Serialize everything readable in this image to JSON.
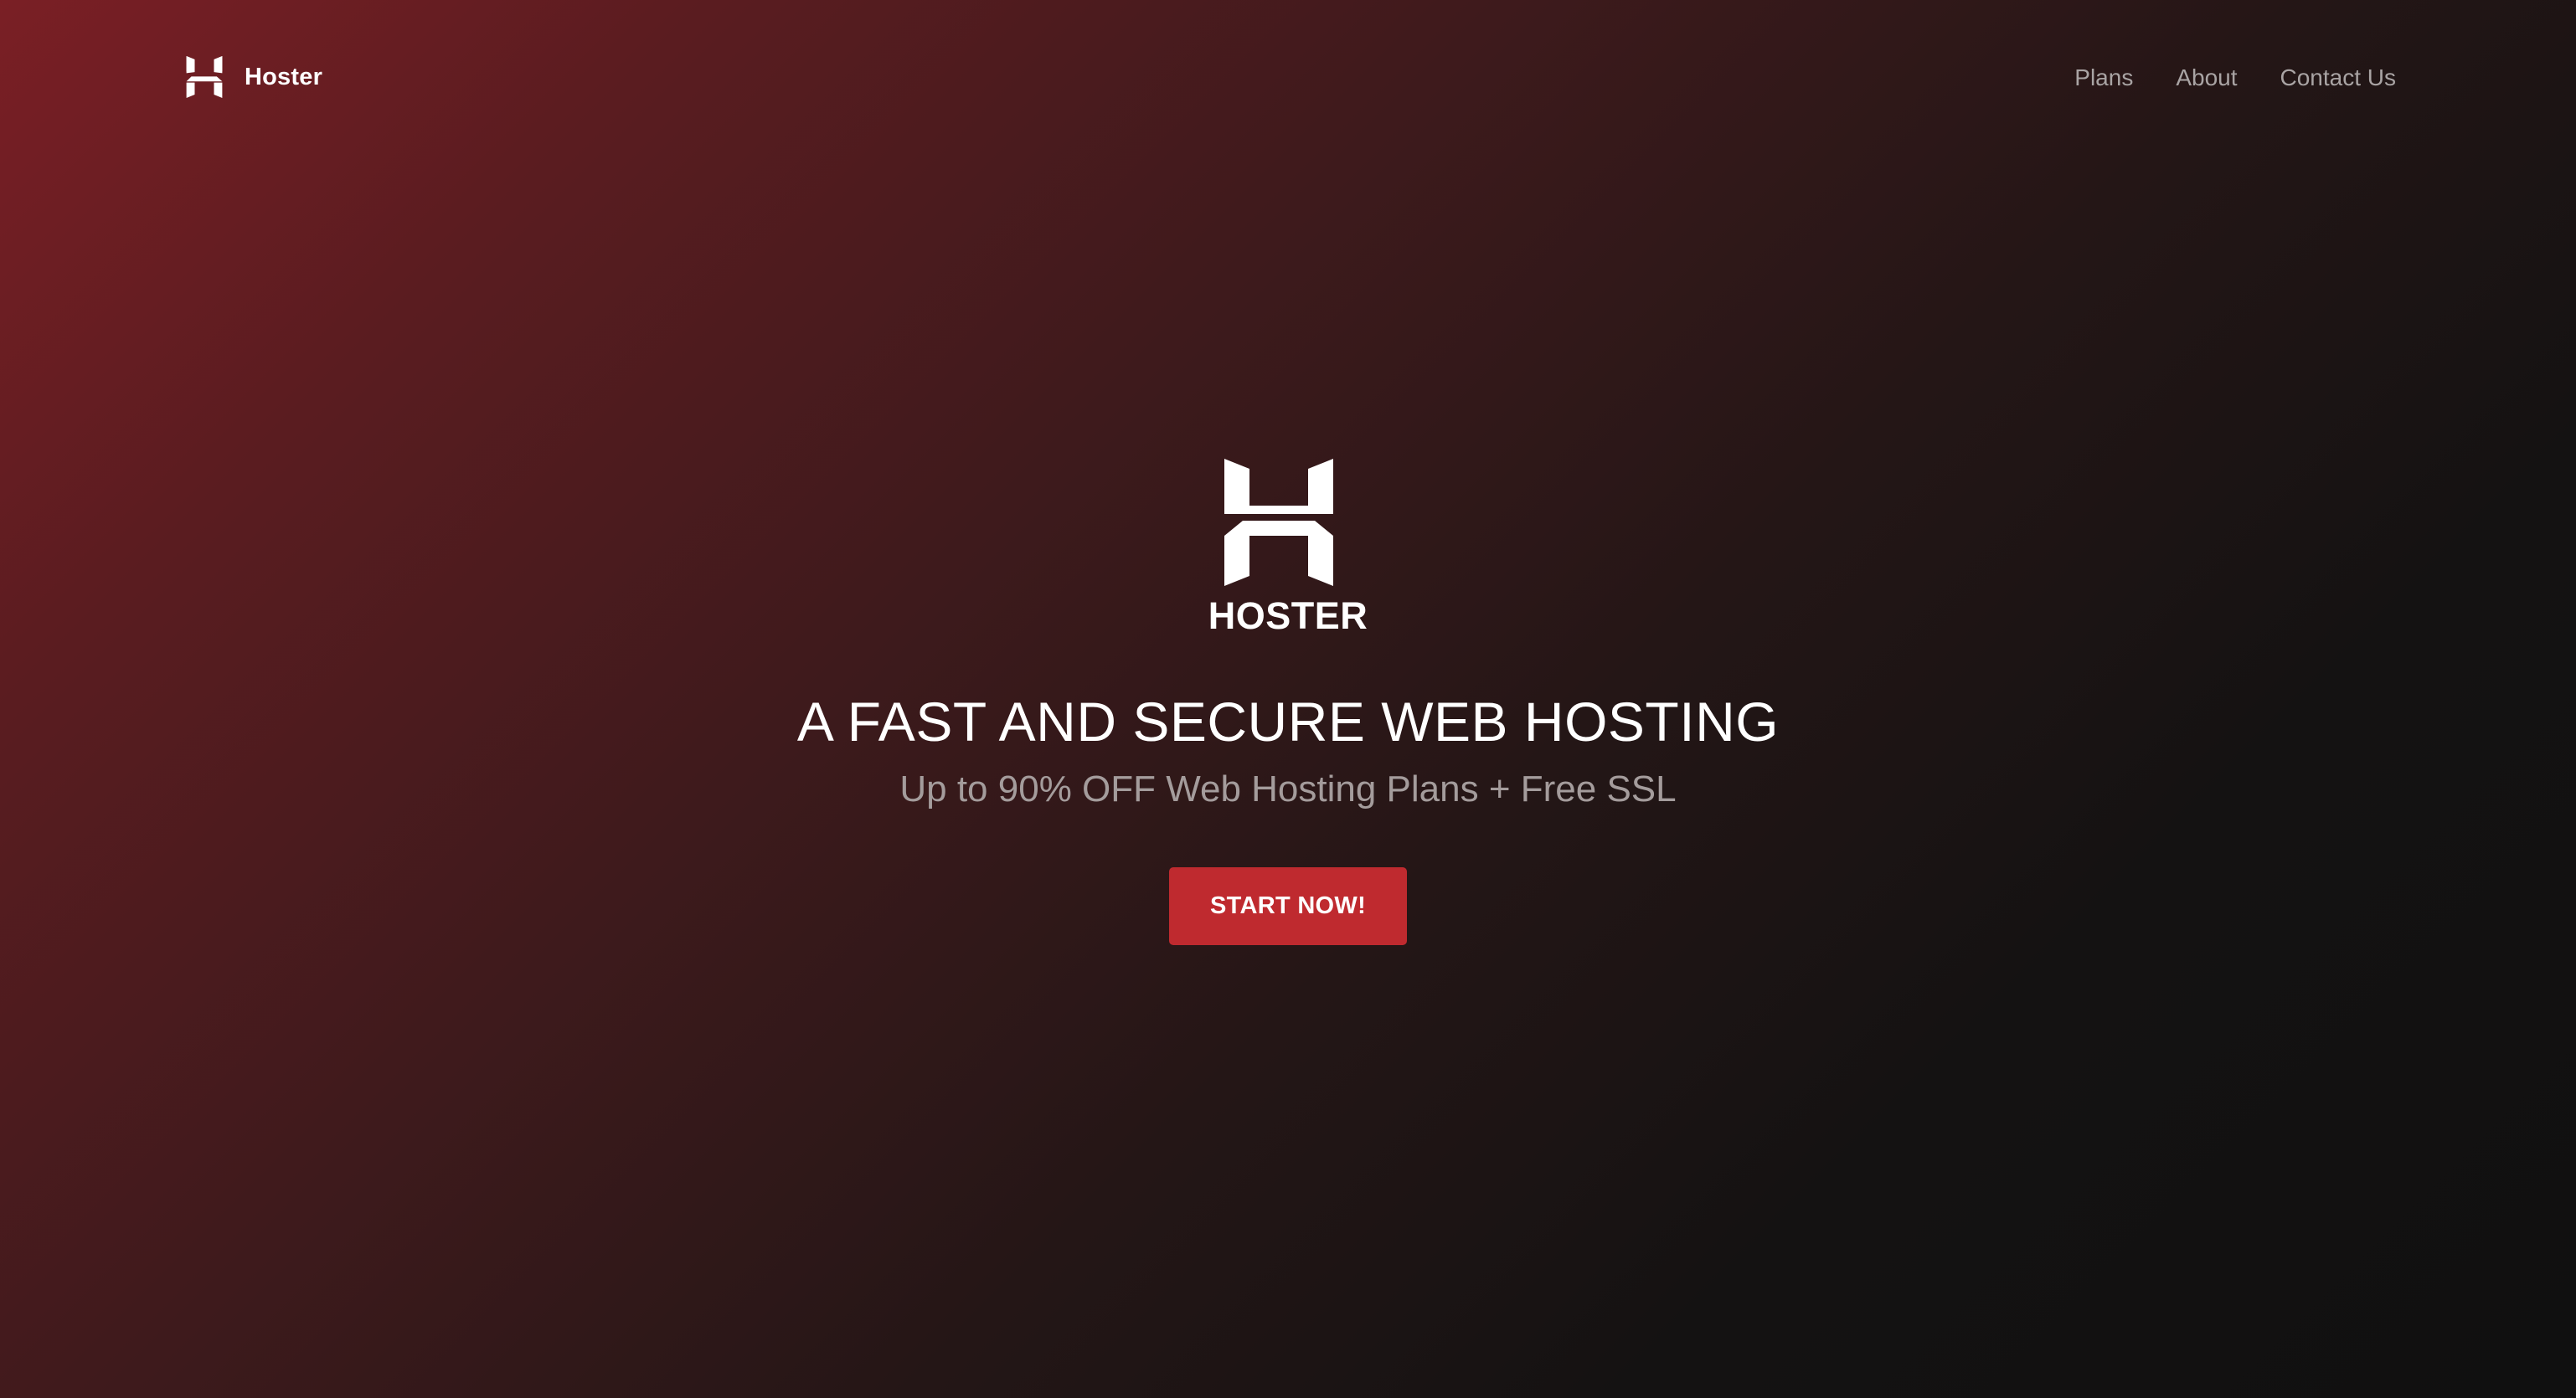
{
  "navbar": {
    "brand_name": "Hoster",
    "links": [
      {
        "label": "Plans"
      },
      {
        "label": "About"
      },
      {
        "label": "Contact Us"
      }
    ]
  },
  "hero": {
    "logo_text": "HOSTER",
    "title": "A FAST AND SECURE WEB HOSTING",
    "subtitle": "Up to 90% OFF Web Hosting Plans + Free SSL",
    "cta_label": "START NOW!"
  },
  "colors": {
    "accent": "#bf2a2f",
    "background_start": "#7a1f25",
    "background_end": "#101010",
    "nav_text": "#a9a4a4",
    "subtitle_text": "#a49c9c"
  },
  "icons": {
    "brand_logo": "hoster-h-logo-icon",
    "hero_logo": "hoster-h-logo-icon"
  }
}
